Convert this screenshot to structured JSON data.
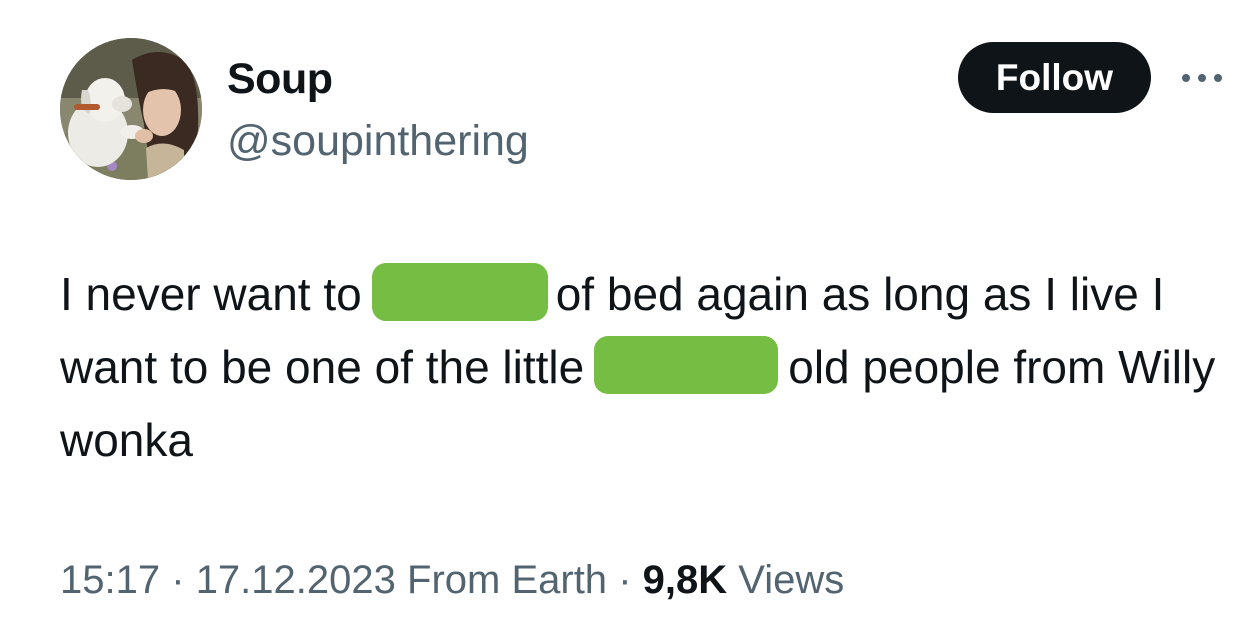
{
  "author": {
    "name": "Soup",
    "handle": "@soupinthering"
  },
  "header": {
    "follow_label": "Follow",
    "more_icon": "more-horizontal-icon"
  },
  "tweet": {
    "segment_1": "I never want to",
    "segment_2": "of bed again as long as I live I want to be one of the little",
    "segment_3": "old people from Willy wonka",
    "redaction_color": "#76bd43"
  },
  "meta": {
    "time": "15:17",
    "separator": "·",
    "date": "17.12.2023",
    "source": "From Earth",
    "views_count": "9,8K",
    "views_label": "Views"
  }
}
